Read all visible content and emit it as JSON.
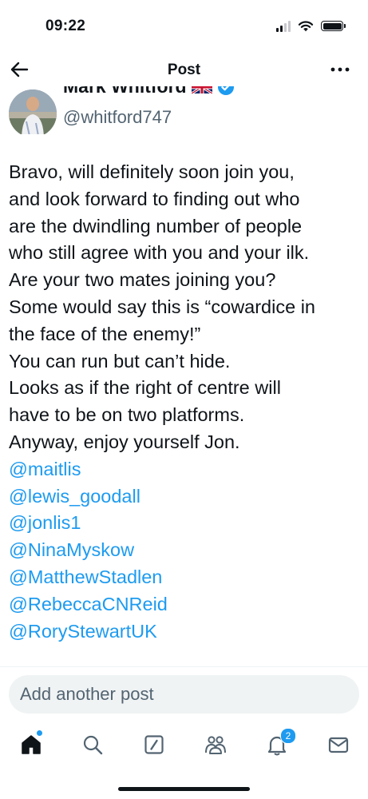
{
  "status_bar": {
    "time": "09:22"
  },
  "nav": {
    "title": "Post"
  },
  "author": {
    "name": "Mark Whitford",
    "flag_icon": "uk-flag-icon",
    "verified_icon": "verified-badge-icon",
    "handle": "@whitford747"
  },
  "post": {
    "lines": [
      "Bravo, will definitely soon join you,",
      "and look forward to finding out who",
      "are the dwindling number of people",
      "who still agree with you and your ilk.",
      "Are your two mates joining you?",
      "Some would say this is “cowardice in",
      "the face of the enemy!”",
      "You can run but can’t hide.",
      "Looks as if the right of centre will",
      "have to be on two platforms.",
      "Anyway, enjoy yourself Jon."
    ],
    "mentions": [
      "@maitlis",
      "@lewis_goodall",
      "@jonlis1",
      "@NinaMyskow",
      "@MatthewStadlen",
      "@RebeccaCNReid",
      "@RoryStewartUK"
    ]
  },
  "reply": {
    "placeholder": "Add another post"
  },
  "tab_bar": {
    "notifications_badge": "2"
  },
  "colors": {
    "accent": "#1d9bf0",
    "text": "#0f1419",
    "secondary": "#536471",
    "reply_bg": "#eff3f4"
  }
}
